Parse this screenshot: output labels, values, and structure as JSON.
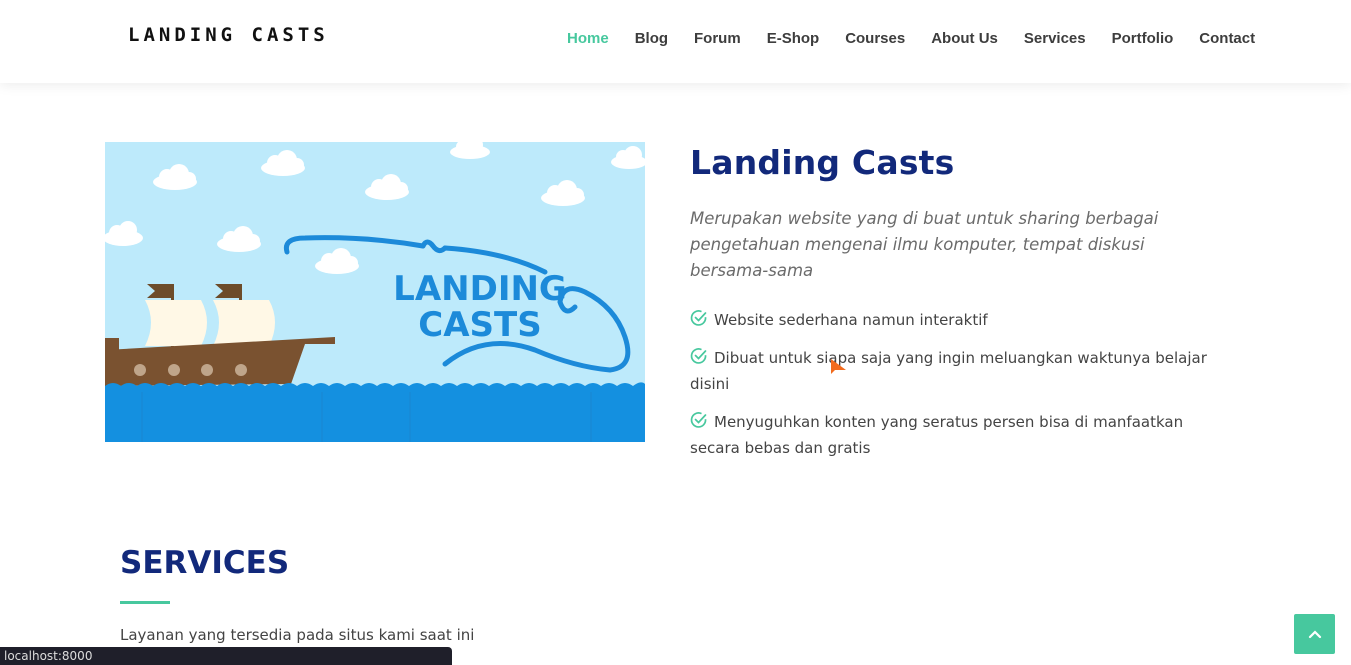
{
  "header": {
    "logo": "LANDING CASTS",
    "nav": [
      {
        "label": "Home",
        "active": true
      },
      {
        "label": "Blog",
        "active": false
      },
      {
        "label": "Forum",
        "active": false
      },
      {
        "label": "E-Shop",
        "active": false
      },
      {
        "label": "Courses",
        "active": false
      },
      {
        "label": "About Us",
        "active": false
      },
      {
        "label": "Services",
        "active": false
      },
      {
        "label": "Portfolio",
        "active": false
      },
      {
        "label": "Contact",
        "active": false
      }
    ]
  },
  "hero_image": {
    "logo_line1": "LANDING",
    "logo_line2": "CASTS"
  },
  "about": {
    "title": "Landing Casts",
    "description": "Merupakan website yang di buat untuk sharing berbagai pengetahuan mengenai ilmu komputer, tempat diskusi bersama-sama",
    "features": [
      "Website sederhana namun interaktif",
      "Dibuat untuk siapa saja yang ingin meluangkan waktunya belajar disini",
      "Menyuguhkan konten yang seratus persen bisa di manfaatkan secara bebas dan gratis"
    ]
  },
  "services": {
    "title": "SERVICES",
    "description": "Layanan yang tersedia pada situs kami saat ini"
  },
  "status_bar": {
    "url": "localhost:8000"
  },
  "icons": {
    "feature_icon": "check-circle-icon",
    "back_to_top_icon": "chevron-up-icon"
  },
  "colors": {
    "accent": "#47c89e",
    "heading": "#12297b",
    "sky": "#bdeafb",
    "sea": "#1490e0",
    "logo_blue": "#1c8ad9"
  }
}
